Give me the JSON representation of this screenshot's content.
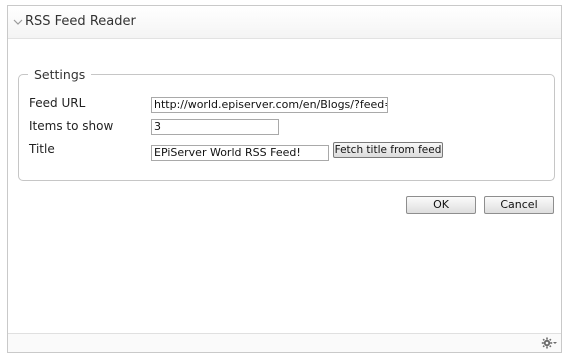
{
  "panel": {
    "title": "RSS Feed Reader",
    "collapse_icon": "chevron-down-icon"
  },
  "settings": {
    "legend": "Settings",
    "feed_url_label": "Feed URL",
    "feed_url_value": "http://world.episerver.com/en/Blogs/?feed=RSS",
    "items_label": "Items to show",
    "items_value": "3",
    "title_label": "Title",
    "title_value": "EPiServer World RSS Feed!",
    "fetch_button": "Fetch title from feed"
  },
  "actions": {
    "ok": "OK",
    "cancel": "Cancel"
  },
  "footer": {
    "gear_icon": "gear-icon"
  }
}
